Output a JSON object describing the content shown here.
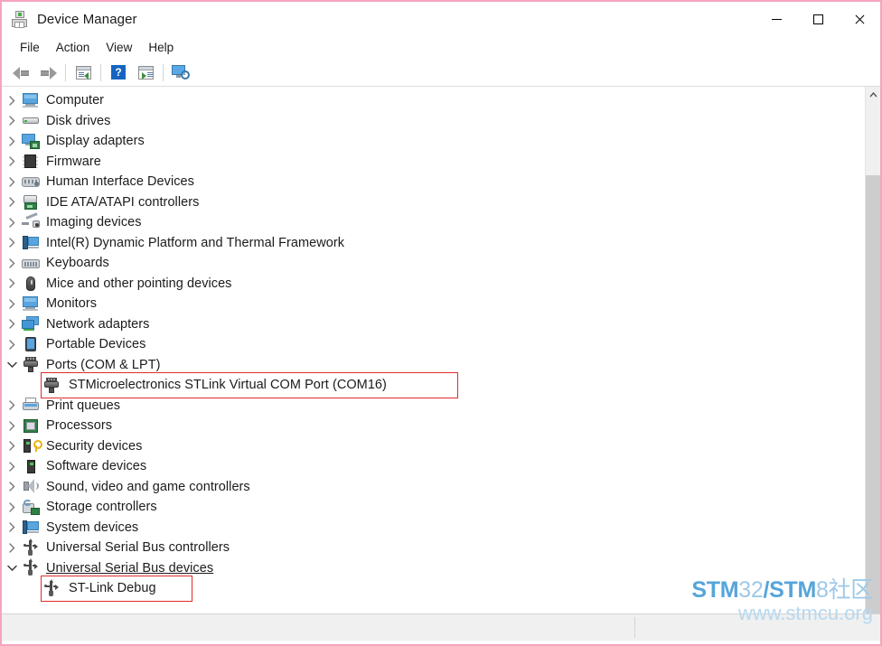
{
  "window": {
    "title": "Device Manager",
    "icon": "device-manager-icon",
    "border_color": "#f6a4bd",
    "controls": {
      "minimize": "minimize-button",
      "maximize": "maximize-button",
      "close": "close-button"
    }
  },
  "menubar": {
    "items": [
      {
        "label": "File"
      },
      {
        "label": "Action"
      },
      {
        "label": "View"
      },
      {
        "label": "Help"
      }
    ]
  },
  "toolbar": {
    "buttons": [
      {
        "name": "back-button",
        "icon": "back-arrow-icon"
      },
      {
        "name": "forward-button",
        "icon": "forward-arrow-icon"
      },
      {
        "name": "properties-button",
        "icon": "properties-window-icon"
      },
      {
        "name": "help-button",
        "icon": "help-question-icon"
      },
      {
        "name": "update-driver-button",
        "icon": "update-window-icon"
      },
      {
        "name": "scan-hardware-changes-button",
        "icon": "scan-monitor-icon"
      }
    ]
  },
  "tree": {
    "items": [
      {
        "label": "Computer",
        "icon": "monitor-icon",
        "expander": "collapsed",
        "level": 0,
        "icon_class": "ic-monitor"
      },
      {
        "label": "Disk drives",
        "icon": "disk-drive-icon",
        "expander": "collapsed",
        "level": 0,
        "icon_class": "ic-disk"
      },
      {
        "label": "Display adapters",
        "icon": "display-adapter-icon",
        "expander": "collapsed",
        "level": 0,
        "icon_class": "ic-display"
      },
      {
        "label": "Firmware",
        "icon": "firmware-chip-icon",
        "expander": "collapsed",
        "level": 0,
        "icon_class": "ic-firmware"
      },
      {
        "label": "Human Interface Devices",
        "icon": "hid-icon",
        "expander": "collapsed",
        "level": 0,
        "icon_class": "ic-hid"
      },
      {
        "label": "IDE ATA/ATAPI controllers",
        "icon": "ide-controller-icon",
        "expander": "collapsed",
        "level": 0,
        "icon_class": "ic-ide"
      },
      {
        "label": "Imaging devices",
        "icon": "imaging-device-icon",
        "expander": "collapsed",
        "level": 0,
        "icon_class": "ic-imaging"
      },
      {
        "label": "Intel(R) Dynamic Platform and Thermal Framework",
        "icon": "system-device-icon",
        "expander": "collapsed",
        "level": 0,
        "icon_class": "ic-intel"
      },
      {
        "label": "Keyboards",
        "icon": "keyboard-icon",
        "expander": "collapsed",
        "level": 0,
        "icon_class": "ic-keyboard"
      },
      {
        "label": "Mice and other pointing devices",
        "icon": "mouse-icon",
        "expander": "collapsed",
        "level": 0,
        "icon_class": "ic-mouse"
      },
      {
        "label": "Monitors",
        "icon": "monitor-icon",
        "expander": "collapsed",
        "level": 0,
        "icon_class": "ic-monitor"
      },
      {
        "label": "Network adapters",
        "icon": "network-adapter-icon",
        "expander": "collapsed",
        "level": 0,
        "icon_class": "ic-network"
      },
      {
        "label": "Portable Devices",
        "icon": "portable-device-icon",
        "expander": "collapsed",
        "level": 0,
        "icon_class": "ic-portable"
      },
      {
        "label": "Ports (COM & LPT)",
        "icon": "port-icon",
        "expander": "expanded",
        "level": 0,
        "icon_class": "ic-port"
      },
      {
        "label": "STMicroelectronics STLink Virtual COM Port (COM16)",
        "icon": "port-icon",
        "expander": "none",
        "level": 1,
        "icon_class": "ic-port",
        "highlighted": true
      },
      {
        "label": "Print queues",
        "icon": "printer-icon",
        "expander": "collapsed",
        "level": 0,
        "icon_class": "ic-print"
      },
      {
        "label": "Processors",
        "icon": "processor-icon",
        "expander": "collapsed",
        "level": 0,
        "icon_class": "ic-cpu"
      },
      {
        "label": "Security devices",
        "icon": "security-device-icon",
        "expander": "collapsed",
        "level": 0,
        "icon_class": "ic-sec"
      },
      {
        "label": "Software devices",
        "icon": "software-device-icon",
        "expander": "collapsed",
        "level": 0,
        "icon_class": "ic-soft"
      },
      {
        "label": "Sound, video and game controllers",
        "icon": "speaker-icon",
        "expander": "collapsed",
        "level": 0,
        "icon_class": "ic-sound"
      },
      {
        "label": "Storage controllers",
        "icon": "storage-controller-icon",
        "expander": "collapsed",
        "level": 0,
        "icon_class": "ic-storage"
      },
      {
        "label": "System devices",
        "icon": "system-device-icon",
        "expander": "collapsed",
        "level": 0,
        "icon_class": "ic-sys"
      },
      {
        "label": "Universal Serial Bus controllers",
        "icon": "usb-icon",
        "expander": "collapsed",
        "level": 0,
        "icon_class": "ic-usb"
      },
      {
        "label": "Universal Serial Bus devices",
        "icon": "usb-icon",
        "expander": "expanded",
        "level": 0,
        "icon_class": "ic-usb",
        "hovered": true
      },
      {
        "label": "ST-Link Debug",
        "icon": "usb-icon",
        "expander": "none",
        "level": 1,
        "icon_class": "ic-usb",
        "highlighted": true
      }
    ],
    "highlight_color": "#e02b2b"
  },
  "scrollbar": {
    "up_arrow": "scroll-up-arrow",
    "thumb": "scroll-thumb"
  },
  "statusbar": {
    "text": ""
  },
  "watermark": {
    "line1_a": "STM",
    "line1_b": "32",
    "line1_c": "/STM",
    "line1_d": "8社区",
    "line2": "www.stmcu.org",
    "color": "#56a5da"
  }
}
